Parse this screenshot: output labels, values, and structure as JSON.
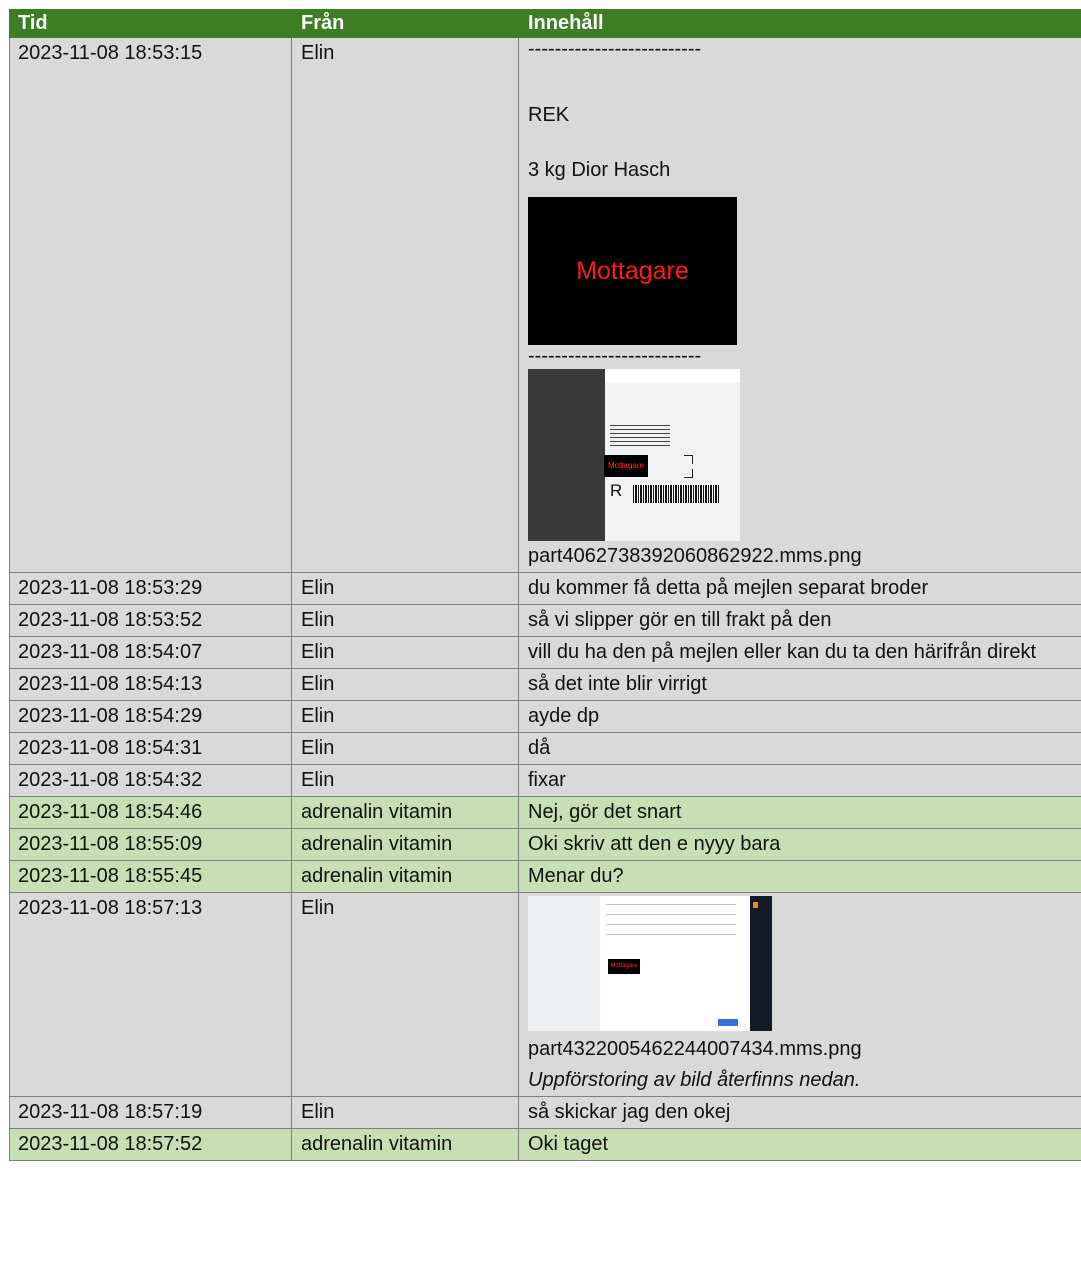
{
  "headers": {
    "time": "Tid",
    "from": "Från",
    "content": "Innehåll"
  },
  "first_message": {
    "time": "2023-11-08 18:53:15",
    "from": "Elin",
    "dashes_top": "--------------------------",
    "line1": "REK",
    "line2": "3 kg Dior Hasch",
    "image_label": "Mottagare",
    "dashes_mid": "--------------------------",
    "label_image_text": "Mottagare",
    "label_image_letter": "R",
    "attachment": "part4062738392060862922.mms.png"
  },
  "messages": [
    {
      "time": "2023-11-08 18:53:29",
      "from": "Elin",
      "content": "du kommer få detta på mejlen separat broder",
      "sender": "elin"
    },
    {
      "time": "2023-11-08 18:53:52",
      "from": "Elin",
      "content": "så vi slipper gör en till frakt på den",
      "sender": "elin"
    },
    {
      "time": "2023-11-08 18:54:07",
      "from": "Elin",
      "content": "vill du ha den på mejlen eller kan du ta den härifrån direkt",
      "sender": "elin"
    },
    {
      "time": "2023-11-08 18:54:13",
      "from": "Elin",
      "content": "så det inte blir virrigt",
      "sender": "elin"
    },
    {
      "time": "2023-11-08 18:54:29",
      "from": "Elin",
      "content": "ayde dp",
      "sender": "elin"
    },
    {
      "time": "2023-11-08 18:54:31",
      "from": "Elin",
      "content": "då",
      "sender": "elin"
    },
    {
      "time": "2023-11-08 18:54:32",
      "from": "Elin",
      "content": "fixar",
      "sender": "elin"
    },
    {
      "time": "2023-11-08 18:54:46",
      "from": "adrenalin vitamin",
      "content": "Nej, gör det snart",
      "sender": "adr"
    },
    {
      "time": "2023-11-08 18:55:09",
      "from": "adrenalin vitamin",
      "content": "Oki skriv att den e nyyy bara",
      "sender": "adr"
    },
    {
      "time": "2023-11-08 18:55:45",
      "from": "adrenalin vitamin",
      "content": "Menar du?",
      "sender": "adr"
    }
  ],
  "screenshot_message": {
    "time": "2023-11-08 18:57:13",
    "from": "Elin",
    "image_label": "Mottagare",
    "attachment": "part4322005462244007434.mms.png",
    "note": "Uppförstoring av bild återfinns nedan."
  },
  "tail_messages": [
    {
      "time": "2023-11-08 18:57:19",
      "from": "Elin",
      "content": "så skickar jag den okej",
      "sender": "elin"
    },
    {
      "time": "2023-11-08 18:57:52",
      "from": "adrenalin vitamin",
      "content": "Oki taget",
      "sender": "adr"
    }
  ],
  "colors": {
    "header_bg": "#3d7d24",
    "elin_row": "#d9d9d9",
    "adrenalin_row": "#c6e0b4",
    "image_text": "#ff1b1b"
  }
}
